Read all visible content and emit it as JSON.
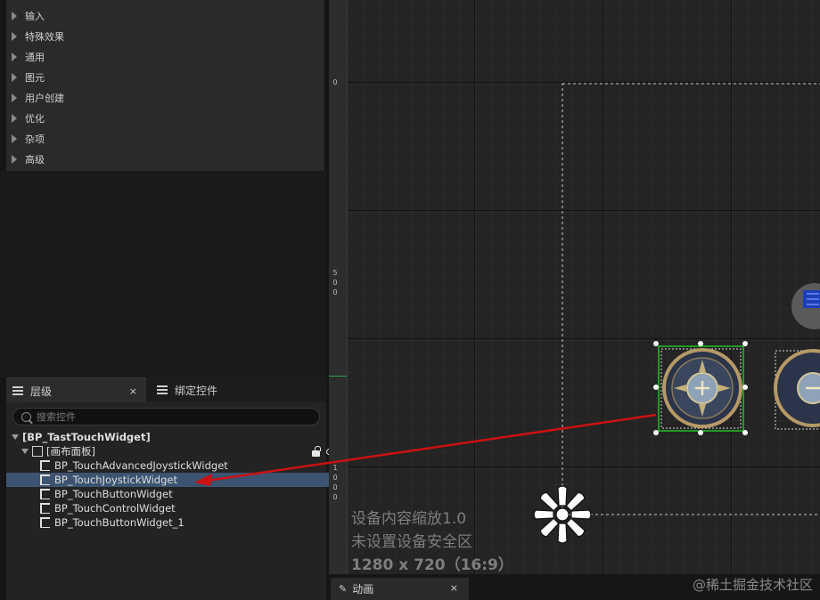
{
  "palette": {
    "categories": [
      "输入",
      "特殊效果",
      "通用",
      "图元",
      "用户创建",
      "优化",
      "杂项",
      "高级"
    ]
  },
  "hierarchy": {
    "tab_label": "层级",
    "tab_close": "×",
    "binding_tab_label": "绑定控件",
    "search_placeholder": "搜索控件",
    "root": "[BP_TastTouchWidget]",
    "canvas": "[画布面板]",
    "children": [
      "BP_TouchAdvancedJoystickWidget",
      "BP_TouchJoystickWidget",
      "BP_TouchButtonWidget",
      "BP_TouchControlWidget",
      "BP_TouchButtonWidget_1"
    ]
  },
  "designer": {
    "ruler_labels": [
      "0",
      "5\n0\n0",
      "1\n0\n0\n0"
    ],
    "dpi_scale_text": "设备内容缩放1.0",
    "safe_zone_text": "未设置设备安全区",
    "resolution_text": "1280 x 720（16:9）"
  },
  "animation": {
    "tab_label": "动画",
    "tab_close": "×"
  },
  "watermark": "@稀土掘金技术社区",
  "colors": {
    "selection_row": "#3c5371",
    "selection_box": "#22c022",
    "arrow": "#cc1111"
  }
}
